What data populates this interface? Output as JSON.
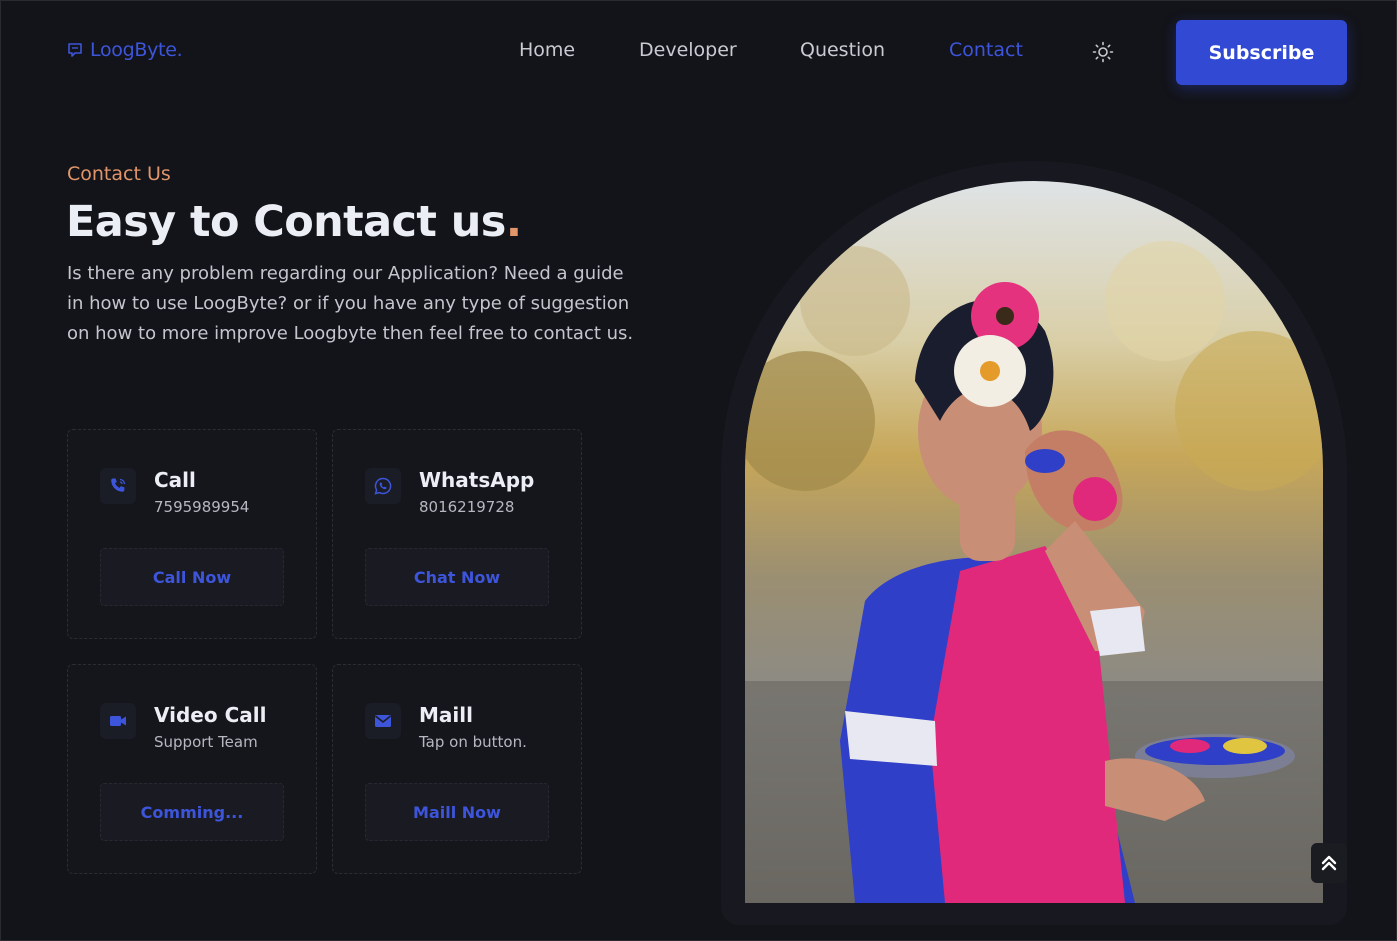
{
  "nav": {
    "logo": "LoogByte.",
    "links": [
      "Home",
      "Developer",
      "Question",
      "Contact"
    ],
    "active": "Contact",
    "subscribe": "Subscribe"
  },
  "hero": {
    "eyebrow": "Contact Us",
    "headline": "Easy to Contact us",
    "headline_dot": ".",
    "description": "Is there any problem regarding our Application? Need a guide in how to use LoogByte? or if you have any type of suggestion on how to more improve Loogbyte then feel free to contact us."
  },
  "cards": [
    {
      "icon": "phone-call-icon",
      "title": "Call",
      "sub": "7595989954",
      "button": "Call Now"
    },
    {
      "icon": "whatsapp-icon",
      "title": "WhatsApp",
      "sub": "8016219728",
      "button": "Chat Now"
    },
    {
      "icon": "video-camera-icon",
      "title": "Video Call",
      "sub": "Support Team",
      "button": "Comming..."
    },
    {
      "icon": "mail-icon",
      "title": "Maill",
      "sub": "Tap on button.",
      "button": "Maill Now"
    }
  ],
  "colors": {
    "accent": "#3d55db",
    "highlight": "#e0956b",
    "background": "#131419"
  }
}
